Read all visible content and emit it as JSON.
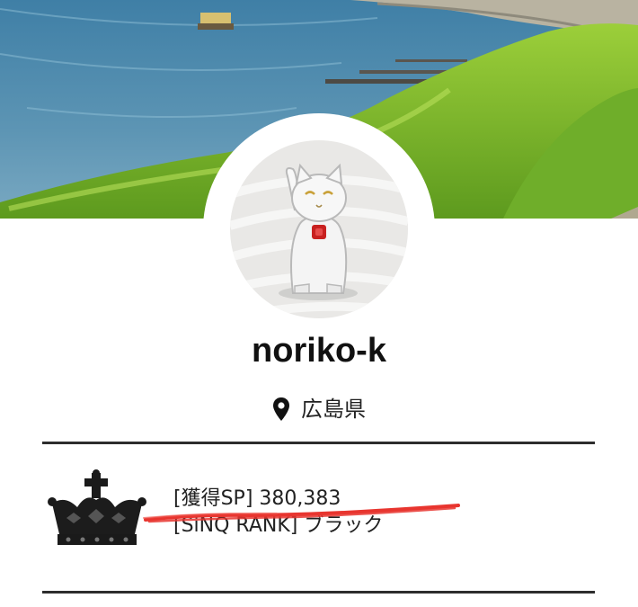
{
  "profile": {
    "username": "noriko-k",
    "location": "広島県"
  },
  "stats": {
    "sp_label": "[獲得SP]",
    "sp_value": "380,383",
    "rank_label": "[SiNQ RANK]",
    "rank_value": "ブラック"
  },
  "icons": {
    "location": "map-pin-icon",
    "rank": "crown-icon"
  },
  "colors": {
    "accent_scribble": "#e8352f",
    "divider": "#2d2d2d"
  }
}
